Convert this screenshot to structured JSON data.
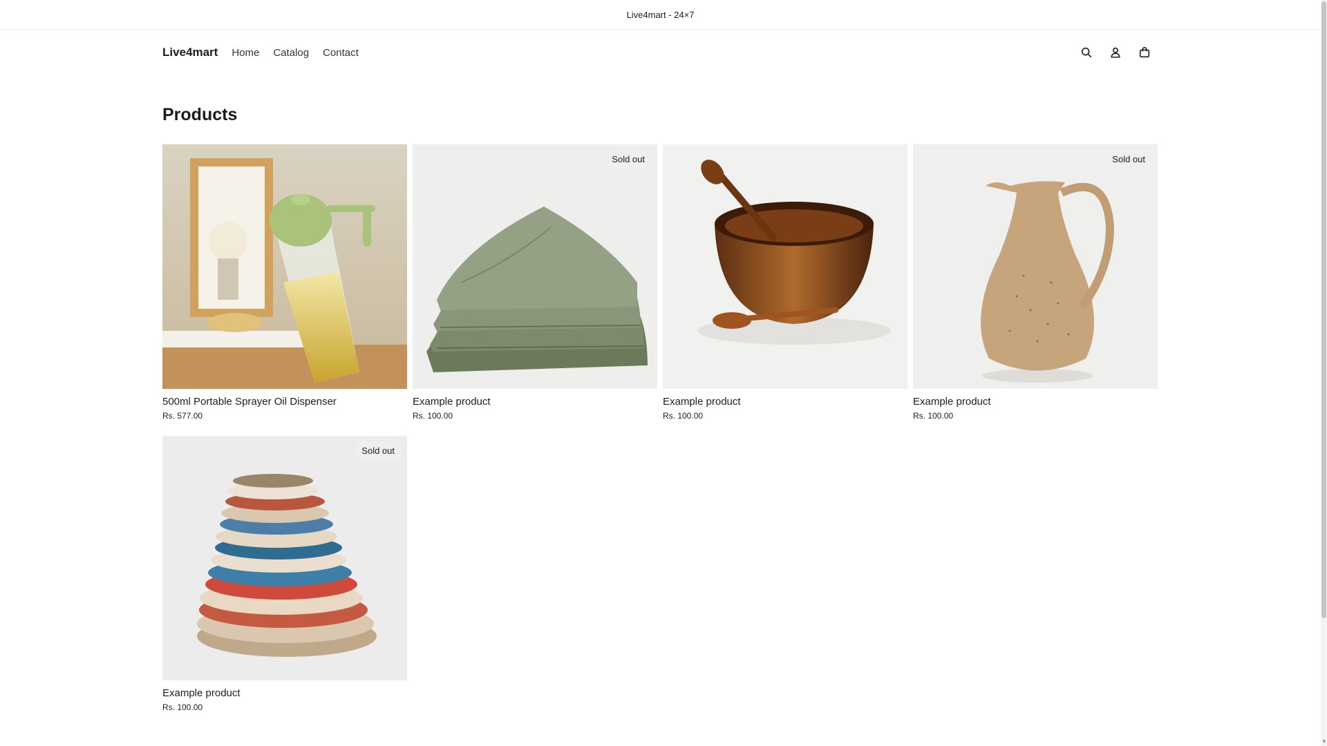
{
  "announcement": {
    "text": "Live4mart - 24×7"
  },
  "header": {
    "logo": "Live4mart",
    "nav": [
      "Home",
      "Catalog",
      "Contact"
    ],
    "icons": [
      "search-icon",
      "account-icon",
      "cart-icon"
    ]
  },
  "page_title": "Products",
  "products": [
    {
      "title": "500ml Portable Sprayer Oil Dispenser",
      "price": "Rs. 577.00",
      "badge": ""
    },
    {
      "title": "Example product",
      "price": "Rs. 100.00",
      "badge": "Sold out"
    },
    {
      "title": "Example product",
      "price": "Rs. 100.00",
      "badge": ""
    },
    {
      "title": "Example product",
      "price": "Rs. 100.00",
      "badge": "Sold out"
    },
    {
      "title": "Example product",
      "price": "Rs. 100.00",
      "badge": "Sold out"
    }
  ],
  "colors": {
    "text": "#1c1c1c",
    "badge_bg": "#efefef",
    "border": "#ececec"
  }
}
